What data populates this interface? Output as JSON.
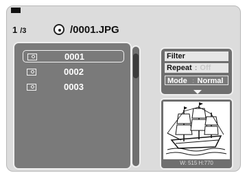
{
  "header": {
    "current_index": "1",
    "total": "/3",
    "path": "/0001.JPG"
  },
  "files": [
    {
      "name": "0001",
      "selected": true
    },
    {
      "name": "0002",
      "selected": false
    },
    {
      "name": "0003",
      "selected": false
    }
  ],
  "menu": {
    "filter_label": "Filter",
    "repeat_label": "Repeat",
    "repeat_colon": ":",
    "repeat_value": "Off",
    "mode_label": "Mode",
    "mode_colon": ":",
    "mode_value": "Normal"
  },
  "preview": {
    "dimensions": "W: 515  H:770",
    "image_subject": "sailing-ship"
  },
  "icons": {
    "disc": "disc-icon",
    "file": "image-file-icon",
    "more": "down-arrow-icon"
  },
  "colors": {
    "panel_bg": "#7a7a7a",
    "screen_bg": "#dcdcdc",
    "menu_item_bg": "#e6e6e6"
  }
}
